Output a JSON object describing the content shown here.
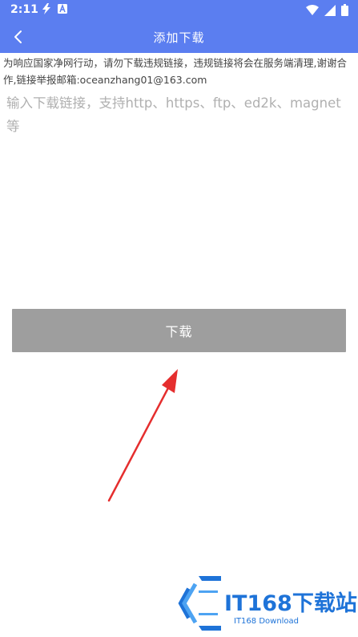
{
  "status_bar": {
    "time": "2:11",
    "left_icons": [
      "flash-icon",
      "a-notification-icon"
    ],
    "right_icons": [
      "wifi-icon",
      "signal-icon",
      "battery-icon"
    ]
  },
  "app_bar": {
    "title": "添加下载",
    "back_icon": "chevron-left-icon"
  },
  "notice": "为响应国家净网行动，请勿下载违规链接，违规链接将会在服务端清理,谢谢合作,链接举报邮箱:oceanzhang01@163.com",
  "input": {
    "value": "",
    "placeholder": "输入下载链接，支持http、https、ftp、ed2k、magnet等"
  },
  "download_button": {
    "label": "下载"
  },
  "watermark": {
    "title": "IT168下载站",
    "subtitle": "IT168 Download"
  },
  "colors": {
    "primary": "#5b7ef0",
    "button": "#9e9e9e",
    "arrow": "#e52e2e",
    "watermark": "#1e73d8"
  }
}
